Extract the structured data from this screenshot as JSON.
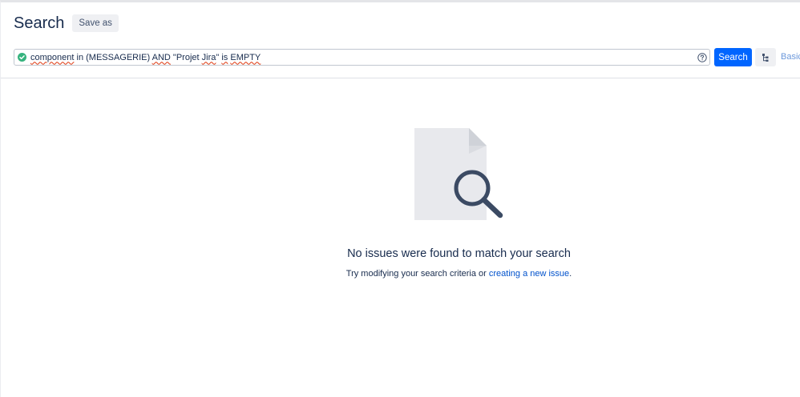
{
  "header": {
    "title": "Search",
    "save_as_label": "Save as"
  },
  "query": {
    "status_icon": "check-circle-icon",
    "valid_color": "#36b37e",
    "tokens": {
      "t1": "component",
      "t2": " in (MESSAGERIE) ",
      "t3": "AND",
      "t4": " \"Projet ",
      "t5": "Jira",
      "t6": "\" ",
      "t7": "is",
      "t8": " ",
      "t9": "EMPTY"
    },
    "help_icon": "help-circle-icon"
  },
  "toolbar": {
    "search_label": "Search",
    "search_color": "#0065ff",
    "tree_icon": "hierarchy-icon",
    "basic_label": "Basic"
  },
  "empty_state": {
    "illustration": "document-magnifier-icon",
    "title": "No issues were found to match your search",
    "message_prefix": "Try modifying your search criteria or ",
    "link_label": "creating a new issue",
    "message_suffix": "."
  }
}
